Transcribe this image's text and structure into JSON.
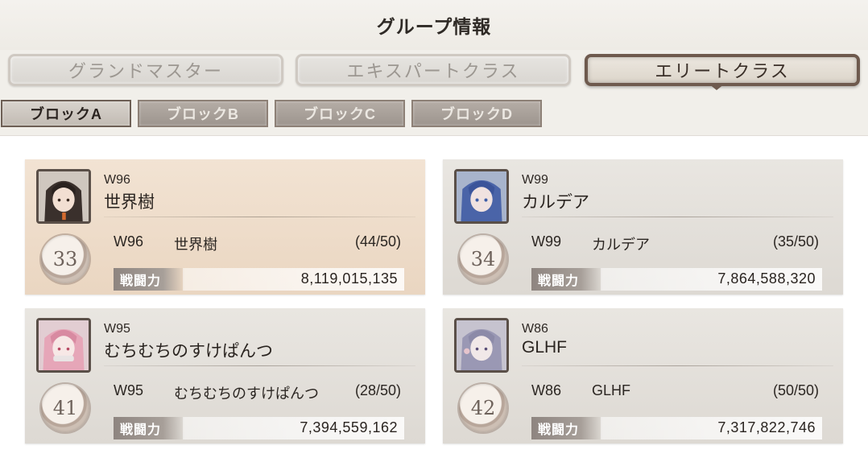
{
  "header": {
    "title": "グループ情報"
  },
  "tabs": [
    {
      "label": "グランドマスター",
      "active": false
    },
    {
      "label": "エキスパートクラス",
      "active": false
    },
    {
      "label": "エリートクラス",
      "active": true
    }
  ],
  "blocks": [
    {
      "label": "ブロックA",
      "active": true
    },
    {
      "label": "ブロックB",
      "active": false
    },
    {
      "label": "ブロックC",
      "active": false
    },
    {
      "label": "ブロックD",
      "active": false
    }
  ],
  "power_label": "戦闘力",
  "cards": [
    {
      "server": "W96",
      "name": "世界樹",
      "rank": "33",
      "count": "(44/50)",
      "power": "8,119,015,135",
      "highlight": true,
      "avatar_icon": "avatar-dark-hair-icon"
    },
    {
      "server": "W99",
      "name": "カルデア",
      "rank": "34",
      "count": "(35/50)",
      "power": "7,864,588,320",
      "highlight": false,
      "avatar_icon": "avatar-blue-hair-icon"
    },
    {
      "server": "W95",
      "name": "むちむちのすけぱんつ",
      "rank": "41",
      "count": "(28/50)",
      "power": "7,394,559,162",
      "highlight": false,
      "avatar_icon": "avatar-pink-hair-icon"
    },
    {
      "server": "W86",
      "name": "GLHF",
      "rank": "42",
      "count": "(50/50)",
      "power": "7,317,822,746",
      "highlight": false,
      "avatar_icon": "avatar-silver-hair-icon"
    }
  ],
  "colors": {
    "active_tab_border": "#6e5a4e",
    "highlight_card": "#f2e3d3",
    "power_label_bg": "#8e8580"
  }
}
